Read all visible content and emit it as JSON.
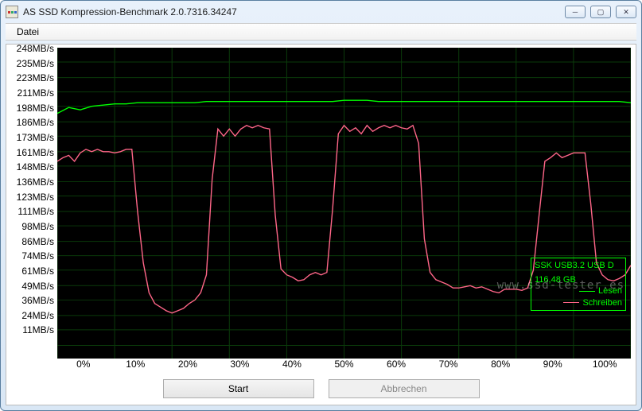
{
  "window": {
    "title": "AS SSD Kompression-Benchmark 2.0.7316.34247"
  },
  "menubar": {
    "file": "Datei"
  },
  "legend": {
    "device": "SSK USB3.2 USB D",
    "capacity": "116,48 GB",
    "read_label": "Lesen",
    "write_label": "Schreiben",
    "read_color": "#00ff00",
    "write_color": "#ff6688"
  },
  "watermark": "www.ssd-tester.es",
  "buttons": {
    "start": "Start",
    "cancel": "Abbrechen"
  },
  "chart_data": {
    "type": "line",
    "xlabel": "",
    "ylabel": "",
    "x_unit": "%",
    "y_unit": "MB/s",
    "xlim": [
      0,
      100
    ],
    "ylim": [
      0,
      260
    ],
    "y_ticks": [
      11,
      24,
      36,
      49,
      61,
      74,
      86,
      98,
      111,
      123,
      136,
      148,
      161,
      173,
      186,
      198,
      211,
      223,
      235,
      248
    ],
    "y_tick_labels": [
      "11MB/s",
      "24MB/s",
      "36MB/s",
      "49MB/s",
      "61MB/s",
      "74MB/s",
      "86MB/s",
      "98MB/s",
      "111MB/s",
      "123MB/s",
      "136MB/s",
      "148MB/s",
      "161MB/s",
      "173MB/s",
      "186MB/s",
      "198MB/s",
      "211MB/s",
      "223MB/s",
      "235MB/s",
      "248MB/s"
    ],
    "x_ticks": [
      0,
      10,
      20,
      30,
      40,
      50,
      60,
      70,
      80,
      90,
      100
    ],
    "x_tick_labels": [
      "0%",
      "10%",
      "20%",
      "30%",
      "40%",
      "50%",
      "60%",
      "70%",
      "80%",
      "90%",
      "100%"
    ],
    "series": [
      {
        "name": "Lesen",
        "color": "#00ff00",
        "x": [
          0,
          2,
          4,
          6,
          8,
          10,
          12,
          14,
          16,
          18,
          20,
          22,
          24,
          26,
          28,
          30,
          32,
          34,
          36,
          38,
          40,
          42,
          44,
          46,
          48,
          50,
          52,
          54,
          56,
          58,
          60,
          62,
          64,
          66,
          68,
          70,
          72,
          74,
          76,
          78,
          80,
          82,
          84,
          86,
          88,
          90,
          92,
          94,
          96,
          98,
          100
        ],
        "y": [
          205,
          210,
          208,
          211,
          212,
          213,
          213,
          214,
          214,
          214,
          214,
          214,
          214,
          215,
          215,
          215,
          215,
          215,
          215,
          215,
          215,
          215,
          215,
          215,
          215,
          216,
          216,
          216,
          215,
          215,
          215,
          215,
          215,
          215,
          215,
          215,
          215,
          215,
          215,
          215,
          215,
          215,
          215,
          215,
          215,
          215,
          215,
          215,
          215,
          215,
          214
        ]
      },
      {
        "name": "Schreiben",
        "color": "#ff6688",
        "x": [
          0,
          1,
          2,
          3,
          4,
          5,
          6,
          7,
          8,
          9,
          10,
          11,
          12,
          13,
          14,
          15,
          16,
          17,
          18,
          19,
          20,
          21,
          22,
          23,
          24,
          25,
          26,
          27,
          28,
          29,
          30,
          31,
          32,
          33,
          34,
          35,
          36,
          37,
          38,
          39,
          40,
          41,
          42,
          43,
          44,
          45,
          46,
          47,
          48,
          49,
          50,
          51,
          52,
          53,
          54,
          55,
          56,
          57,
          58,
          59,
          60,
          61,
          62,
          63,
          64,
          65,
          66,
          67,
          68,
          69,
          70,
          71,
          72,
          73,
          74,
          75,
          76,
          77,
          78,
          79,
          80,
          81,
          82,
          83,
          84,
          85,
          86,
          87,
          88,
          89,
          90,
          91,
          92,
          93,
          94,
          95,
          96,
          97,
          98,
          99,
          100
        ],
        "y": [
          165,
          168,
          170,
          165,
          172,
          175,
          173,
          175,
          173,
          173,
          172,
          173,
          175,
          175,
          123,
          80,
          55,
          46,
          43,
          40,
          38,
          40,
          42,
          46,
          49,
          55,
          70,
          150,
          192,
          186,
          192,
          186,
          192,
          195,
          193,
          195,
          193,
          192,
          120,
          75,
          70,
          68,
          65,
          66,
          70,
          72,
          70,
          72,
          125,
          188,
          195,
          190,
          193,
          188,
          195,
          190,
          193,
          195,
          193,
          195,
          193,
          192,
          195,
          180,
          100,
          72,
          66,
          64,
          62,
          59,
          59,
          60,
          61,
          59,
          60,
          58,
          56,
          55,
          58,
          58,
          58,
          57,
          59,
          74,
          120,
          165,
          168,
          172,
          168,
          170,
          172,
          172,
          172,
          130,
          80,
          70,
          66,
          65,
          67,
          70,
          78
        ]
      }
    ]
  }
}
